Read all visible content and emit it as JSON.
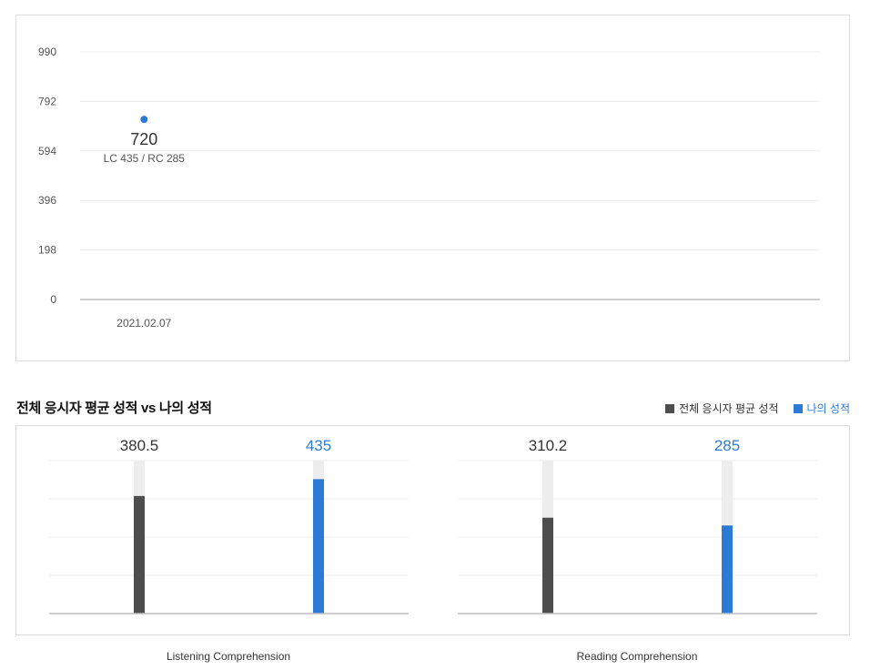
{
  "colors": {
    "avg": "#4d4d4d",
    "mine": "#2d7ad6",
    "bar_bg": "#ededed",
    "grid": "#ececec",
    "axis": "#bdbdbd"
  },
  "chart_data": [
    {
      "type": "scatter",
      "yticks": [
        "990",
        "792",
        "594",
        "396",
        "198",
        "0"
      ],
      "ylim": [
        0,
        990
      ],
      "x": [
        "2021.02.07"
      ],
      "points": [
        {
          "x": "2021.02.07",
          "y": 720,
          "label": "720",
          "sub_label": "LC 435 / RC 285"
        }
      ]
    },
    {
      "type": "bar",
      "title": "전체 응시자 평균 성적 vs 나의 성적",
      "legend": [
        "전체 응시자 평균 성적",
        "나의 성적"
      ],
      "legend_position": "top-right",
      "groups": [
        {
          "category": "Listening Comprehension",
          "max": 495,
          "bars": [
            {
              "series": "전체 응시자 평균 성적",
              "value": 380.5,
              "label": "380.5"
            },
            {
              "series": "나의 성적",
              "value": 435,
              "label": "435"
            }
          ]
        },
        {
          "category": "Reading Comprehension",
          "max": 495,
          "bars": [
            {
              "series": "전체 응시자 평균 성적",
              "value": 310.2,
              "label": "310.2"
            },
            {
              "series": "나의 성적",
              "value": 285,
              "label": "285"
            }
          ]
        }
      ]
    }
  ]
}
